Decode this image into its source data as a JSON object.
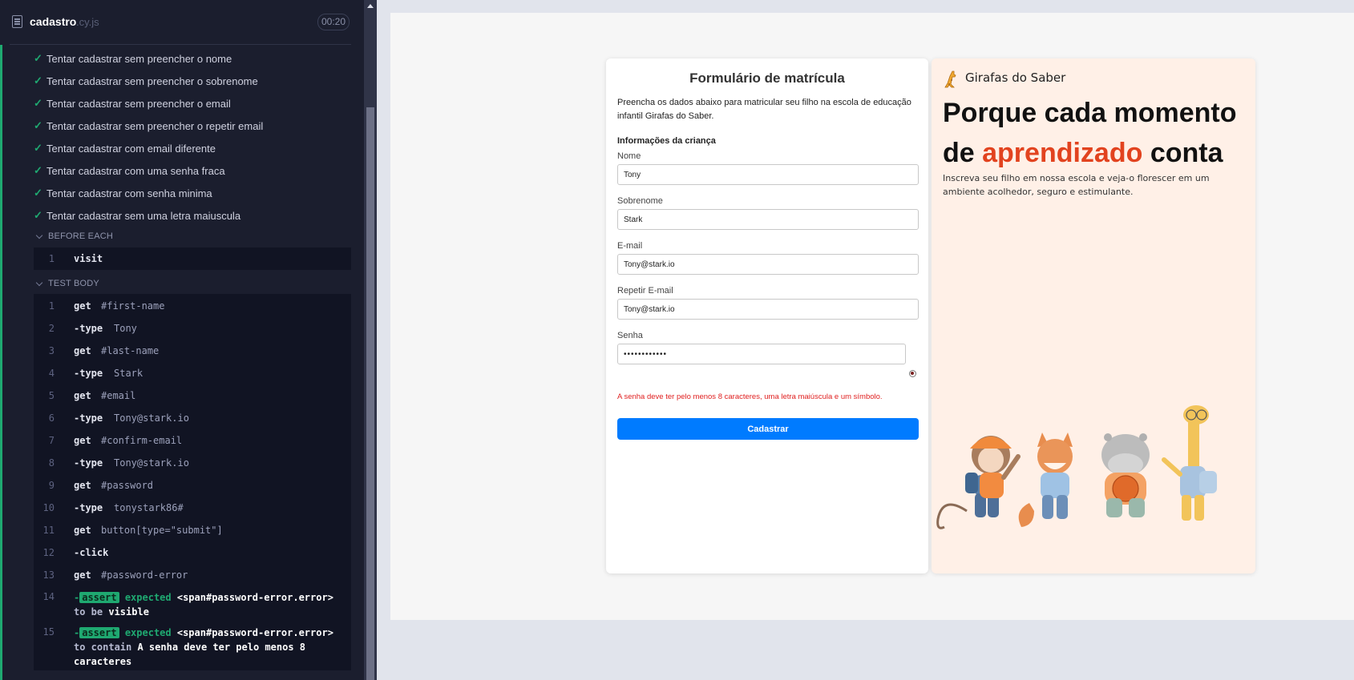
{
  "runner": {
    "spec_name": "cadastro",
    "spec_ext": ".cy.js",
    "timer": "00:20",
    "tests": [
      "Tentar cadastrar sem preencher o nome",
      "Tentar cadastrar sem preencher o sobrenome",
      "Tentar cadastrar sem preencher o email",
      "Tentar cadastrar sem preencher o repetir email",
      "Tentar cadastrar com email diferente",
      "Tentar cadastrar com uma senha fraca",
      "Tentar cadastrar com senha minima",
      "Tentar cadastrar sem uma letra maiuscula"
    ],
    "before_each": {
      "label": "BEFORE EACH",
      "commands": [
        {
          "num": "1",
          "name": "visit",
          "arg": ""
        }
      ]
    },
    "test_body": {
      "label": "TEST BODY",
      "commands": [
        {
          "num": "1",
          "name": "get",
          "arg": "#first-name"
        },
        {
          "num": "2",
          "name": "-type",
          "arg": "Tony"
        },
        {
          "num": "3",
          "name": "get",
          "arg": "#last-name"
        },
        {
          "num": "4",
          "name": "-type",
          "arg": "Stark"
        },
        {
          "num": "5",
          "name": "get",
          "arg": "#email"
        },
        {
          "num": "6",
          "name": "-type",
          "arg": "Tony@stark.io"
        },
        {
          "num": "7",
          "name": "get",
          "arg": "#confirm-email"
        },
        {
          "num": "8",
          "name": "-type",
          "arg": "Tony@stark.io"
        },
        {
          "num": "9",
          "name": "get",
          "arg": "#password"
        },
        {
          "num": "10",
          "name": "-type",
          "arg": "tonystark86#"
        },
        {
          "num": "11",
          "name": "get",
          "arg": "button[type=\"submit\"]"
        },
        {
          "num": "12",
          "name": "-click",
          "arg": ""
        },
        {
          "num": "13",
          "name": "get",
          "arg": "#password-error"
        }
      ],
      "asserts": [
        {
          "num": "14",
          "badge": "assert",
          "expected": "expected",
          "subject": "<span#password-error.error>",
          "connector": "to be",
          "value": "visible"
        },
        {
          "num": "15",
          "badge": "assert",
          "expected": "expected",
          "subject": "<span#password-error.error>",
          "connector": "to contain",
          "value": "A senha deve ter pelo menos 8 caracteres"
        }
      ]
    }
  },
  "form": {
    "title": "Formulário de matrícula",
    "intro": "Preencha os dados abaixo para matricular seu filho na escola de educação infantil Girafas do Saber.",
    "section": "Informações da criança",
    "fields": [
      {
        "label": "Nome",
        "value": "Tony"
      },
      {
        "label": "Sobrenome",
        "value": "Stark"
      },
      {
        "label": "E-mail",
        "value": "Tony@stark.io"
      },
      {
        "label": "Repetir E-mail",
        "value": "Tony@stark.io"
      },
      {
        "label": "Senha",
        "value": "••••••••••••"
      }
    ],
    "password_error": "A senha deve ter pelo menos 8 caracteres, uma letra maiúscula e um símbolo.",
    "submit": "Cadastrar"
  },
  "promo": {
    "brand": "Girafas do Saber",
    "headline_1": "Porque cada momento de ",
    "headline_accent": "aprendizado",
    "headline_2": " conta",
    "subtitle": "Inscreva seu filho em nossa escola e veja-o florescer em um ambiente acolhedor, seguro e estimulante."
  },
  "colors": {
    "runner_bg": "#1b1e2e",
    "pass": "#1fa971",
    "primary": "#007bff",
    "accent": "#e2431f",
    "error": "#e02020",
    "promo_bg": "#fff0e7"
  },
  "icons": [
    "spec-file-icon",
    "check-icon",
    "chevron-down-icon",
    "eye-icon",
    "giraffe-logo-icon"
  ]
}
